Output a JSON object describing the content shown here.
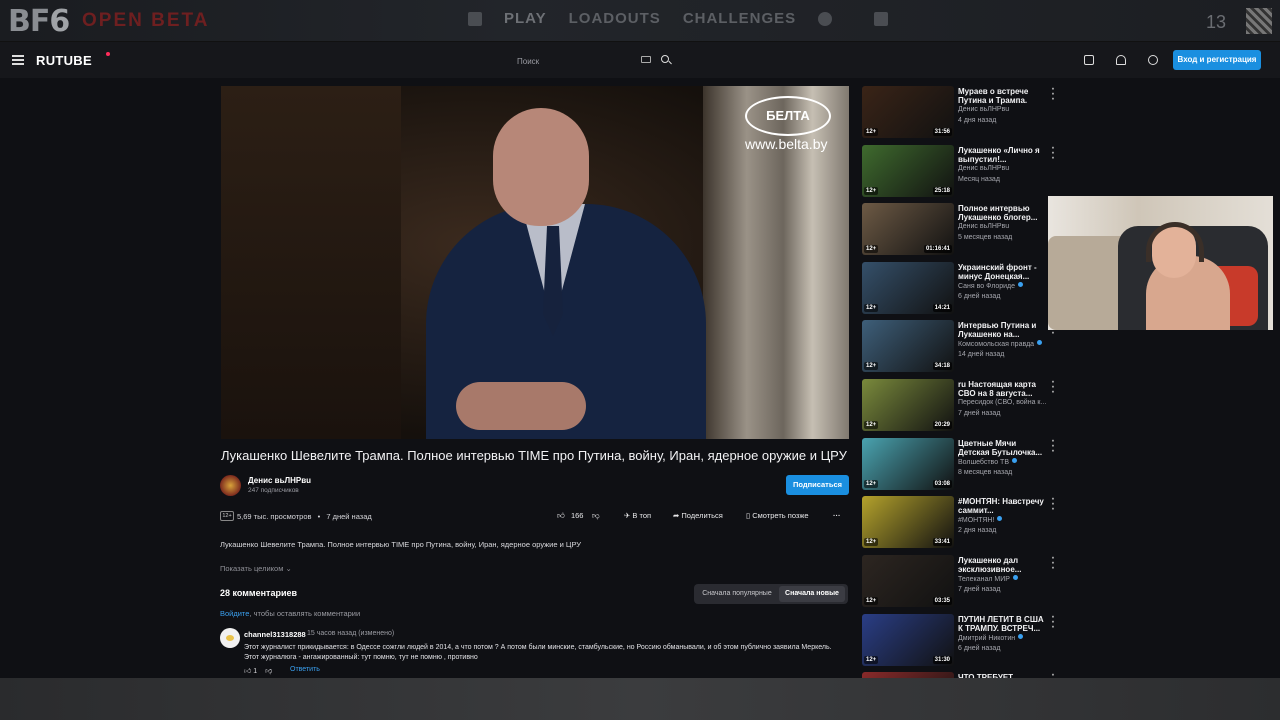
{
  "game": {
    "logo": "BF",
    "logo_num": "6",
    "open": "OPEN BETA",
    "nav": [
      "PLAY",
      "LOADOUTS",
      "CHALLENGES"
    ],
    "count": "13"
  },
  "header": {
    "logo": "RUTUBE",
    "search_placeholder": "Поиск",
    "login": "Вход и регистрация"
  },
  "player": {
    "watermark": "БЕЛТА",
    "watermark_url": "www.belta.by"
  },
  "video": {
    "title": "Лукашенко Шевелите Трампа. Полное интервью TIME про Путина, войну, Иран, ядерное оружие и ЦРУ",
    "channel": "Денис вьЛНРвu",
    "subscribers": "247 подписчиков",
    "subscribe": "Подписаться",
    "age": "12+",
    "views": "5,69 тыс. просмотров",
    "separator": "•",
    "date": "7 дней назад",
    "likes": "166",
    "to_top": "В топ",
    "share": "Поделиться",
    "watch_later": "Смотреть позже",
    "description": "Лукашенко Шевелите Трампа. Полное интервью TIME про Путина, войну, Иран, ядерное оружие и ЦРУ",
    "show_full": "Показать целиком"
  },
  "comments": {
    "count": "28 комментариев",
    "sort_popular": "Сначала популярные",
    "sort_new": "Сначала новые",
    "login_link": "Войдите",
    "login_text": ", чтобы оставлять комментарии",
    "items": [
      {
        "user": "channel31318288",
        "time": "15 часов назад (изменено)",
        "text": "Этот журналист прикидывается: в Одессе сожгли людей в 2014, а что потом ? А потом были минские, стамбульские, но Россию обманывали, и об этом публично заявила Меркель. Этот журналюга - ангажированный: тут помню, тут не помню , противно",
        "likes": "1",
        "reply": "Ответить"
      }
    ]
  },
  "recommendations": [
    {
      "title": "Мураев о встрече Путина и Трампа.",
      "channel": "Денис вьЛНРвu",
      "date": "4 дня назад",
      "duration": "31:56",
      "age": "12+",
      "thumb": "#3a2417",
      "verified": false
    },
    {
      "title": "Лукашенко «Лично я выпустил!...",
      "channel": "Денис вьЛНРвu",
      "date": "Месяц назад",
      "duration": "25:18",
      "age": "12+",
      "thumb": "#3f6b2e",
      "verified": false
    },
    {
      "title": "Полное интервью Лукашенко блогер...",
      "channel": "Денис вьЛНРвu",
      "date": "5 месяцев назад",
      "duration": "01:16:41",
      "age": "12+",
      "thumb": "#6d5a45",
      "verified": false
    },
    {
      "title": "Украинский фронт - минус Донецкая...",
      "channel": "Саня во Флориде",
      "date": "6 дней назад",
      "duration": "14:21",
      "age": "12+",
      "thumb": "#35506a",
      "verified": true
    },
    {
      "title": "Интервью Путина и Лукашенко на...",
      "channel": "Комсомольская правда",
      "date": "14 дней назад",
      "duration": "34:18",
      "age": "12+",
      "thumb": "#3e5f7a",
      "verified": true
    },
    {
      "title": "ru Настоящая карта СВО на 8 августа...",
      "channel": "Пересидок (СВО, война к...",
      "date": "7 дней назад",
      "duration": "20:29",
      "age": "12+",
      "thumb": "#7a8a3c",
      "verified": false
    },
    {
      "title": "Цветные Мячи Детская Бутылочка...",
      "channel": "Волшебство ТВ",
      "date": "8 месяцев назад",
      "duration": "03:08",
      "age": "12+",
      "thumb": "#4aa3b0",
      "verified": true
    },
    {
      "title": "#МОНТЯН: Навстречу саммит...",
      "channel": "#МОНТЯН!",
      "date": "2 дня назад",
      "duration": "33:41",
      "age": "12+",
      "thumb": "#b4a22c",
      "verified": true
    },
    {
      "title": "Лукашенко дал эксклюзивное...",
      "channel": "Телеканал МИР",
      "date": "7 дней назад",
      "duration": "03:35",
      "age": "12+",
      "thumb": "#2d2621",
      "verified": true
    },
    {
      "title": "ПУТИН ЛЕТИТ В США К ТРАМПУ. ВСТРЕЧ...",
      "channel": "Дмитрий Никотин",
      "date": "6 дней назад",
      "duration": "31:30",
      "age": "12+",
      "thumb": "#2a3e86",
      "verified": true
    },
    {
      "title": "ЧТО ТРЕБУЕТ ПУТИН...",
      "channel": "",
      "date": "",
      "duration": "",
      "age": "",
      "thumb": "#8a2a2a",
      "verified": false
    }
  ],
  "colors": {
    "accent": "#1a8fe0",
    "background": "#0f1014",
    "link": "#3aa0f0"
  }
}
